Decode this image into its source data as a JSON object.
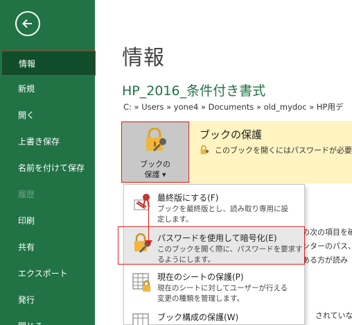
{
  "sidebar": {
    "items": [
      {
        "label": "情報",
        "state": "selected"
      },
      {
        "label": "新規",
        "state": "normal"
      },
      {
        "label": "開く",
        "state": "normal"
      },
      {
        "label": "上書き保存",
        "state": "normal"
      },
      {
        "label": "名前を付けて保存",
        "state": "normal"
      },
      {
        "label": "履歴",
        "state": "disabled"
      },
      {
        "label": "印刷",
        "state": "normal"
      },
      {
        "label": "共有",
        "state": "normal"
      },
      {
        "label": "エクスポート",
        "state": "normal"
      },
      {
        "label": "発行",
        "state": "normal"
      },
      {
        "label": "閉じる",
        "state": "normal"
      }
    ],
    "icons": {
      "back": "back-arrow-icon"
    }
  },
  "main": {
    "title": "情報",
    "doc_name": "HP_2016_条件付き書式",
    "breadcrumb": "C: » Users » yone4 » Documents » old_mydoc » HP用デ",
    "protect": {
      "button_line1": "ブックの",
      "button_line2": "保護 ▾",
      "heading": "ブックの保護",
      "description": "このブックを開くにはパスワードが必要です。"
    },
    "behind_texts": [
      "の次の項目を確",
      "ンターのパス、",
      "ある方が読み",
      "されていない書"
    ]
  },
  "menu": {
    "items": [
      {
        "title": "最終版にする(F)",
        "desc1": "ブックを最終版とし、読み取り専用に設",
        "desc2": "定します。",
        "icon": "final-ribbon-icon"
      },
      {
        "title": "パスワードを使用して暗号化(E)",
        "desc1": "このブックを開く際に、パスワードを要求す",
        "desc2": "るようにします。",
        "icon": "encrypt-lock-key-icon"
      },
      {
        "title": "現在のシートの保護(P)",
        "desc1": "現在のシートに対してユーザーが行える",
        "desc2": "変更の種類を管理します。",
        "icon": "sheet-lock-icon"
      },
      {
        "title": "ブック構成の保護(W)",
        "desc1": "",
        "desc2": "",
        "icon": "workbook-structure-icon"
      }
    ]
  },
  "colors": {
    "sidebar": "#217346",
    "selected": "#104e2b",
    "accent_red": "#e02020",
    "protect_bg": "#fff4c2"
  }
}
